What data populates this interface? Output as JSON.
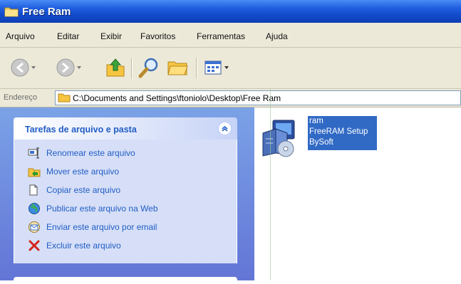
{
  "window": {
    "title": "Free Ram"
  },
  "menubar": {
    "items": [
      "Arquivo",
      "Editar",
      "Exibir",
      "Favoritos",
      "Ferramentas",
      "Ajuda"
    ]
  },
  "toolbar": {
    "buttons": [
      "back-icon",
      "forward-icon",
      "up-folder-icon",
      "search-icon",
      "folders-icon",
      "views-icon"
    ]
  },
  "address": {
    "label": "Endereço",
    "path": "C:\\Documents and Settings\\ftoniolo\\Desktop\\Free Ram"
  },
  "task_pane": {
    "title": "Tarefas de arquivo e pasta",
    "items": [
      {
        "label": "Renomear este arquivo",
        "icon": "rename-icon"
      },
      {
        "label": "Mover este arquivo",
        "icon": "move-icon"
      },
      {
        "label": "Copiar este arquivo",
        "icon": "copy-icon"
      },
      {
        "label": "Publicar este arquivo na Web",
        "icon": "publish-web-icon"
      },
      {
        "label": "Enviar este arquivo por email",
        "icon": "email-icon"
      },
      {
        "label": "Excluir este arquivo",
        "icon": "delete-icon"
      }
    ]
  },
  "file": {
    "name": "ram",
    "description": "FreeRAM Setup",
    "company": "BySoft",
    "selection_color": "#316ac5"
  },
  "colors": {
    "titlebar": "#1f5fe0",
    "chrome": "#ece9d8",
    "task_link": "#215dc6",
    "pane_bg": "#6d8ee0"
  }
}
